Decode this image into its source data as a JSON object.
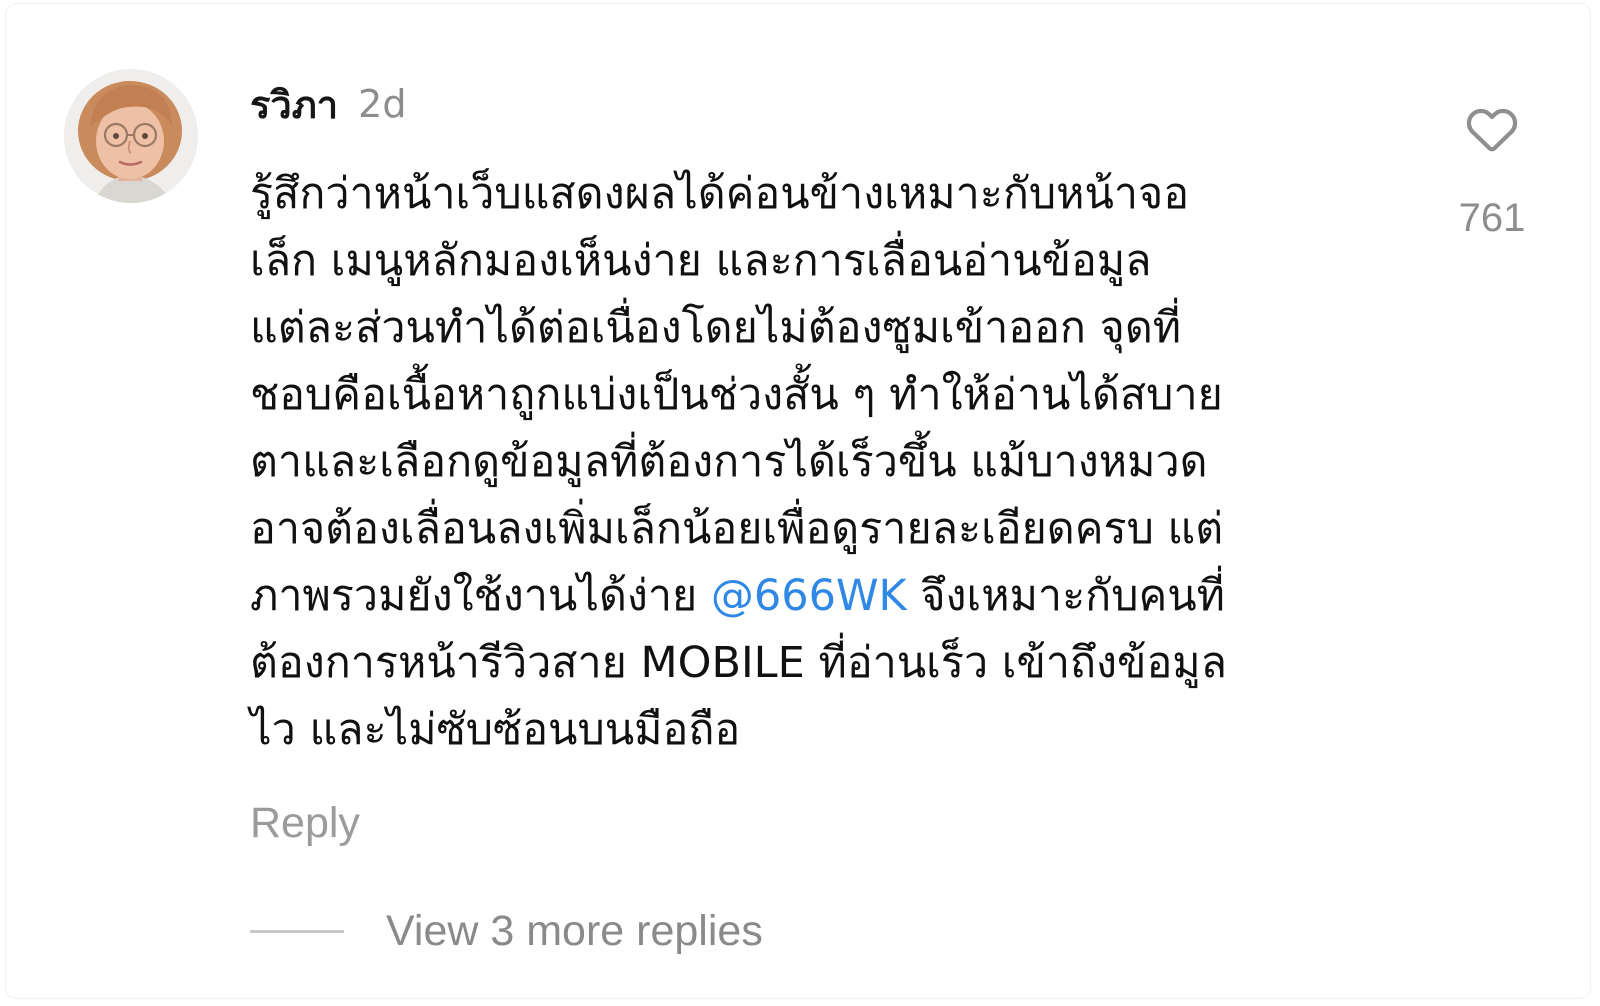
{
  "comment": {
    "username": "รวิภา",
    "timestamp": "2d",
    "text_lines": [
      "รู้สึกว่าหน้าเว็บแสดงผลได้ค่อนข้างเหมาะกับหน้าจอ",
      "เล็ก เมนูหลักมองเห็นง่าย และการเลื่อนอ่านข้อมูล",
      "แต่ละส่วนทำได้ต่อเนื่องโดยไม่ต้องซูมเข้าออก จุดที่",
      "ชอบคือเนื้อหาถูกแบ่งเป็นช่วงสั้น ๆ ทำให้อ่านได้สบาย",
      "ตาและเลือกดูข้อมูลที่ต้องการได้เร็วขึ้น แม้บางหมวด",
      "อาจต้องเลื่อนลงเพิ่มเล็กน้อยเพื่อดูรายละเอียดครบ แต่"
    ],
    "line7_before": "ภาพรวมยังใช้งานได้ง่าย ",
    "mention": "@666WK",
    "line7_after": " จึงเหมาะกับคนที่",
    "text_lines_end": [
      "ต้องการหน้ารีวิวสาย MOBILE ที่อ่านเร็ว เข้าถึงข้อมูล",
      "ไว และไม่ซับซ้อนบนมือถือ"
    ],
    "reply_label": "Reply",
    "view_more_label": "View 3 more replies",
    "like_count": "761",
    "like_icon": "heart-outline-icon"
  },
  "colors": {
    "mention": "#2f88e5",
    "muted": "#8d8d8d",
    "text": "#111111"
  }
}
